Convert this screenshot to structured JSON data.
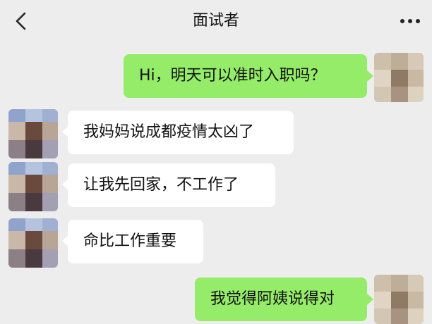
{
  "header": {
    "title": "面试者"
  },
  "messages": [
    {
      "side": "self",
      "text": "Hi，明天可以准时入职吗？"
    },
    {
      "side": "other",
      "text": "我妈妈说成都疫情太凶了"
    },
    {
      "side": "other",
      "text": "让我先回家，不工作了"
    },
    {
      "side": "other",
      "text": "命比工作重要"
    },
    {
      "side": "self",
      "text": "我觉得阿姨说得对"
    }
  ],
  "colors": {
    "background": "#ededed",
    "self_bubble": "#95ec69",
    "other_bubble": "#ffffff"
  },
  "icons": {
    "back": "chevron-left-icon",
    "more": "more-dots-icon",
    "avatar": "pixelated-avatar"
  }
}
